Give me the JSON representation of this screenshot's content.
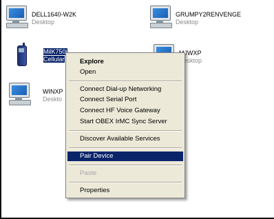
{
  "devices": [
    {
      "name": "DELL1640-W2K",
      "type": "Desktop",
      "icon": "desktop-computer-icon"
    },
    {
      "name": "GRUMPY2RENVENGE",
      "type": "Desktop",
      "icon": "desktop-computer-icon"
    },
    {
      "name": "MilK750i",
      "type": "Cellular",
      "icon": "cell-phone-icon"
    },
    {
      "name": "MJWXP",
      "type": "Desktop",
      "icon": "desktop-computer-icon"
    },
    {
      "name": "WINXP",
      "type": "Deskto",
      "icon": "desktop-computer-icon"
    }
  ],
  "menu": {
    "explore": "Explore",
    "open": "Open",
    "connect_dialup": "Connect Dial-up Networking",
    "connect_serial": "Connect Serial Port",
    "connect_hf": "Connect HF Voice Gateway",
    "start_obex": "Start OBEX IrMC Sync Server",
    "discover": "Discover Available Services",
    "pair": "Pair Device",
    "paste": "Paste",
    "properties": "Properties"
  },
  "colors": {
    "highlight": "#0a246a",
    "menu_bg": "#ece9d8"
  }
}
